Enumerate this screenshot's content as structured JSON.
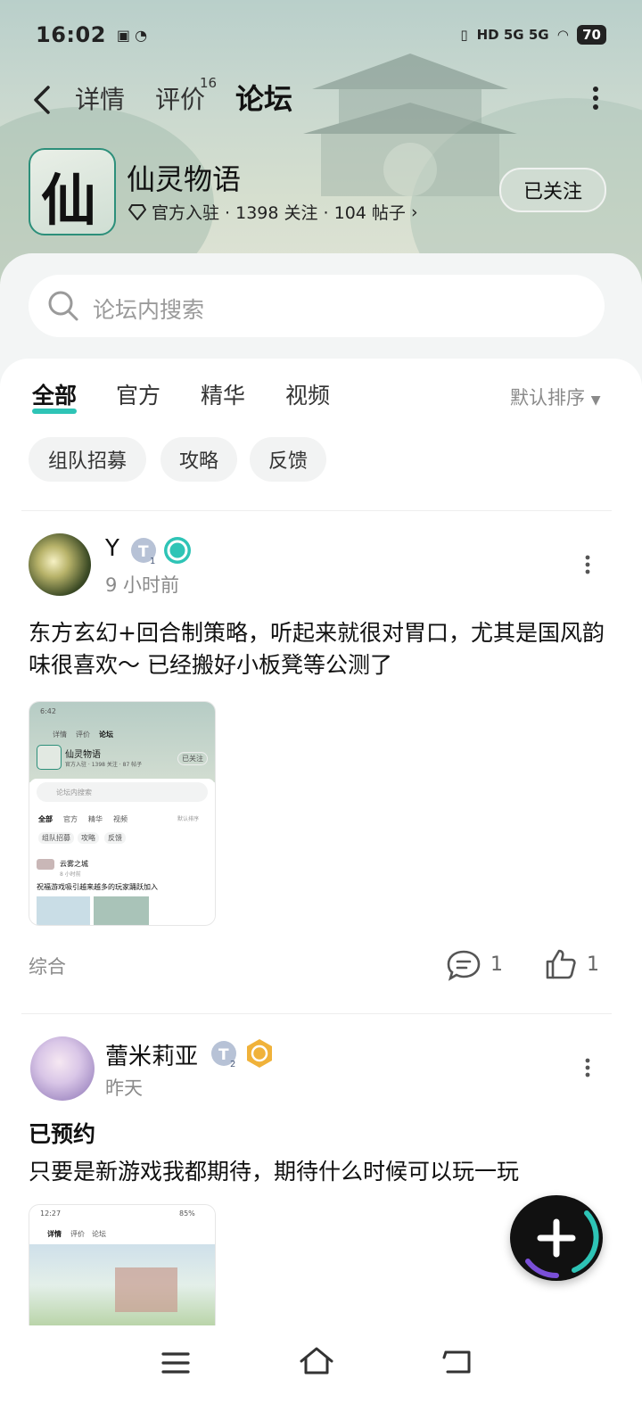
{
  "status_bar": {
    "time": "16:02",
    "network": "HD 5G 5G",
    "battery": "70"
  },
  "nav": {
    "tabs": [
      "详情",
      "评价",
      "论坛"
    ],
    "review_count": "16"
  },
  "game": {
    "name": "仙灵物语",
    "meta": "官方入驻 · 1398 关注 · 104 帖子",
    "follow_label": "已关注",
    "icon_char": "仙"
  },
  "search": {
    "placeholder": "论坛内搜索"
  },
  "filter_tabs": [
    "全部",
    "官方",
    "精华",
    "视频"
  ],
  "sort_label": "默认排序",
  "chips": [
    "组队招募",
    "攻略",
    "反馈"
  ],
  "posts": [
    {
      "user": "Y",
      "time": "9 小时前",
      "body": "东方玄幻+回合制策略，听起来就很对胃口，尤其是国风韵味很喜欢～ 已经搬好小板凳等公测了",
      "tag": "综合",
      "comments": "1",
      "likes": "1",
      "thumb": {
        "time": "6:42",
        "tabs": [
          "详情",
          "评价",
          "论坛"
        ],
        "game": "仙灵物语",
        "meta": "官方入驻 · 1398 关注 · 87 帖子",
        "follow": "已关注",
        "search": "论坛内搜索",
        "filters": [
          "全部",
          "官方",
          "精华",
          "视频"
        ],
        "sort": "默认排序",
        "chips": [
          "组队招募",
          "攻略",
          "反馈"
        ],
        "post_user": "云雾之城",
        "post_time": "8 小时前",
        "post_body": "祝福游戏吸引越来越多的玩家踊跃加入"
      }
    },
    {
      "user": "蕾米莉亚",
      "time": "昨天",
      "title": "已预约",
      "body": "只要是新游戏我都期待，期待什么时候可以玩一玩",
      "thumb": {
        "time": "12:27",
        "battery": "85%",
        "tabs": [
          "详情",
          "评价",
          "论坛"
        ]
      }
    }
  ],
  "colors": {
    "accent": "#2ec4b6",
    "text": "#111111",
    "muted": "#8a8a8a"
  }
}
